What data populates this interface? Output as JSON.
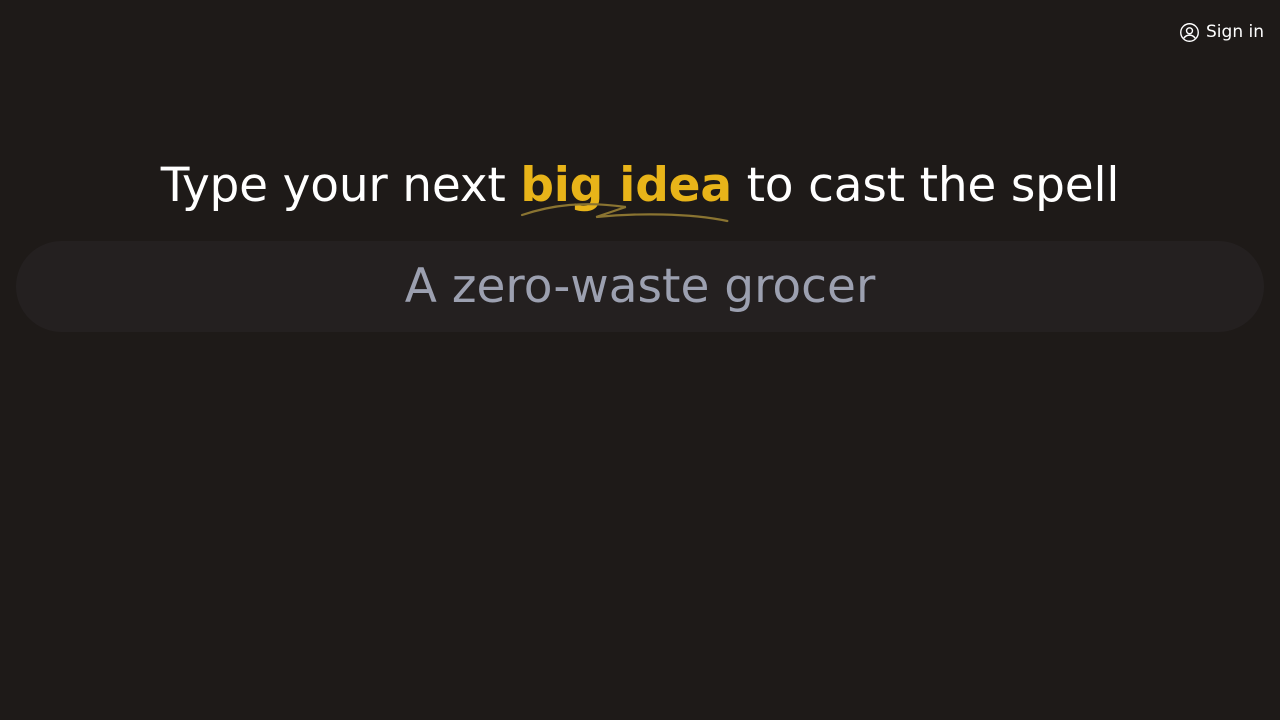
{
  "header": {
    "signin_label": "Sign in",
    "signin_icon": "user-circle-icon"
  },
  "hero": {
    "headline_before": "Type your next ",
    "headline_highlight": "big idea",
    "headline_after": " to cast the spell",
    "highlight_color": "#e8b419"
  },
  "search": {
    "placeholder": "A zero-waste grocer",
    "value": ""
  },
  "colors": {
    "background": "#1e1a18",
    "input_background": "#242020",
    "text": "#ffffff",
    "placeholder": "#9ca0b0"
  }
}
